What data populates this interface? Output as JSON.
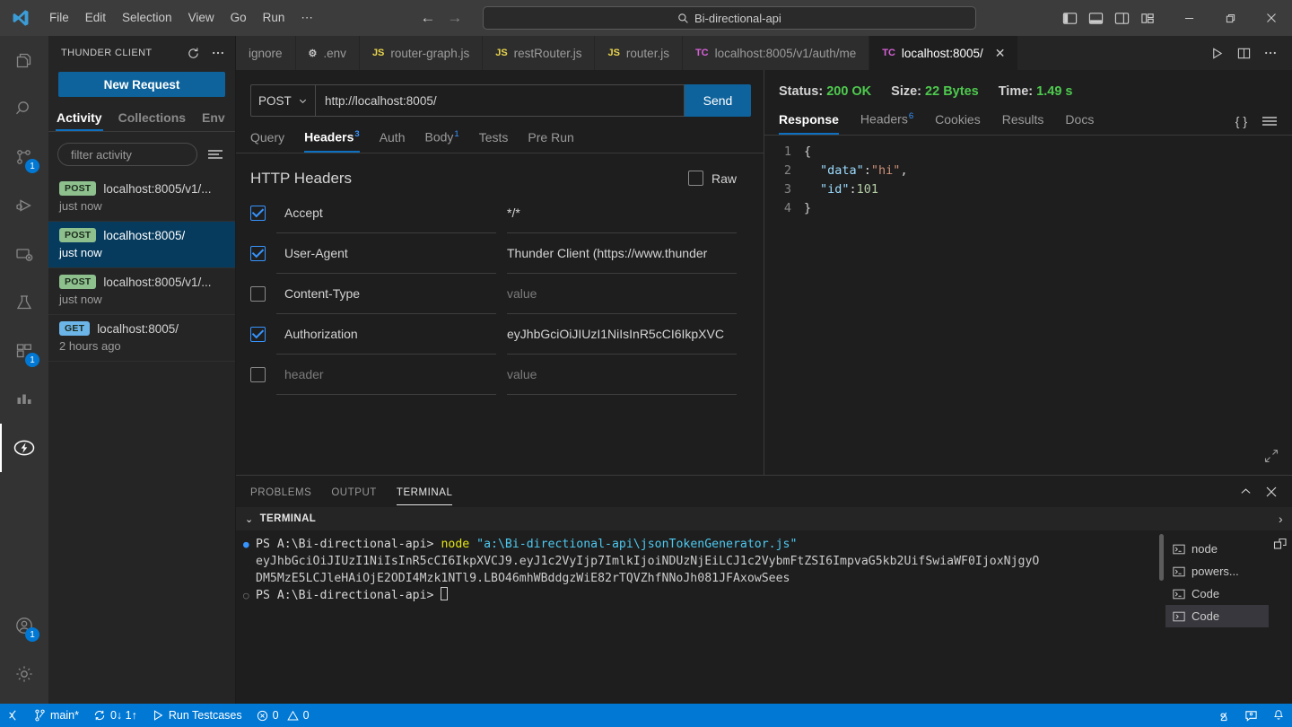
{
  "titlebar": {
    "menus": [
      "File",
      "Edit",
      "Selection",
      "View",
      "Go",
      "Run",
      "⋯"
    ],
    "search_value": "Bi-directional-api",
    "search_icon": "search-icon",
    "back_icon": "arrow-left-icon",
    "forward_icon": "arrow-right-icon",
    "layout_buttons": [
      "toggle-primary-sidebar",
      "toggle-panel",
      "toggle-secondary-sidebar",
      "customize-layout"
    ],
    "window_buttons": [
      "minimize",
      "restore",
      "close"
    ]
  },
  "activitybar": {
    "items": [
      {
        "name": "explorer",
        "icon": "files-icon",
        "badge": "",
        "active": false
      },
      {
        "name": "search",
        "icon": "search-icon",
        "badge": "",
        "active": false
      },
      {
        "name": "source-control",
        "icon": "source-control-icon",
        "badge": "1",
        "active": false
      },
      {
        "name": "run-and-debug",
        "icon": "debug-icon",
        "badge": "",
        "active": false
      },
      {
        "name": "remote-explorer",
        "icon": "remote-icon",
        "badge": "",
        "active": false
      },
      {
        "name": "testing",
        "icon": "beaker-icon",
        "badge": "",
        "active": false
      },
      {
        "name": "extensions",
        "icon": "extensions-icon",
        "badge": "1",
        "active": false
      },
      {
        "name": "chart",
        "icon": "bar-chart-icon",
        "badge": "",
        "active": false
      },
      {
        "name": "thunder-client",
        "icon": "thunderbolt-icon",
        "badge": "",
        "active": true
      }
    ],
    "bottom": [
      {
        "name": "accounts",
        "icon": "account-icon",
        "badge": "1"
      },
      {
        "name": "settings",
        "icon": "gear-icon",
        "badge": ""
      }
    ]
  },
  "sidebar": {
    "title": "THUNDER CLIENT",
    "refresh_icon": "refresh-icon",
    "more_icon": "more-icon",
    "new_request_label": "New Request",
    "tabs": [
      {
        "label": "Activity",
        "active": true
      },
      {
        "label": "Collections",
        "active": false
      },
      {
        "label": "Env",
        "active": false
      }
    ],
    "filter_placeholder": "filter activity",
    "filter_menu_icon": "filter-lines-icon",
    "activity": [
      {
        "method": "POST",
        "url": "localhost:8005/v1/...",
        "time": "just now",
        "selected": false
      },
      {
        "method": "POST",
        "url": "localhost:8005/",
        "time": "just now",
        "selected": true
      },
      {
        "method": "POST",
        "url": "localhost:8005/v1/...",
        "time": "just now",
        "selected": false
      },
      {
        "method": "GET",
        "url": "localhost:8005/",
        "time": "2 hours ago",
        "selected": false
      }
    ]
  },
  "editor_tabs": [
    {
      "label": "ignore",
      "icon": "file-icon",
      "icon_kind": "plain",
      "active": false,
      "closeable": false
    },
    {
      "label": ".env",
      "icon": "gear-icon",
      "icon_kind": "gear",
      "active": false,
      "closeable": false
    },
    {
      "label": "router-graph.js",
      "icon": "js-icon",
      "icon_kind": "js",
      "active": false,
      "closeable": false
    },
    {
      "label": "restRouter.js",
      "icon": "js-icon",
      "icon_kind": "js",
      "active": false,
      "closeable": false
    },
    {
      "label": "router.js",
      "icon": "js-icon",
      "icon_kind": "js",
      "active": false,
      "closeable": false
    },
    {
      "label": "localhost:8005/v1/auth/me",
      "icon": "thunder-client-icon",
      "icon_kind": "tc",
      "active": false,
      "closeable": false
    },
    {
      "label": "localhost:8005/",
      "icon": "thunder-client-icon",
      "icon_kind": "tc",
      "active": true,
      "closeable": true
    }
  ],
  "editor_tab_actions": [
    "run-icon",
    "split-editor-icon",
    "more-icon"
  ],
  "request": {
    "method": "POST",
    "method_chevron": "chevron-down-icon",
    "url": "http://localhost:8005/",
    "send_label": "Send",
    "tabs": [
      {
        "label": "Query",
        "badge": "",
        "active": false
      },
      {
        "label": "Headers",
        "badge": "3",
        "active": true
      },
      {
        "label": "Auth",
        "badge": "",
        "active": false
      },
      {
        "label": "Body",
        "badge": "1",
        "active": false
      },
      {
        "label": "Tests",
        "badge": "",
        "active": false
      },
      {
        "label": "Pre Run",
        "badge": "",
        "active": false
      }
    ],
    "headers_title": "HTTP Headers",
    "raw_label": "Raw",
    "raw_checked": false,
    "headers": [
      {
        "checked": true,
        "name": "Accept",
        "name_placeholder": false,
        "value": "*/*",
        "value_placeholder": false
      },
      {
        "checked": true,
        "name": "User-Agent",
        "name_placeholder": false,
        "value": "Thunder Client (https://www.thunder",
        "value_placeholder": false
      },
      {
        "checked": false,
        "name": "Content-Type",
        "name_placeholder": false,
        "value": "value",
        "value_placeholder": true
      },
      {
        "checked": true,
        "name": "Authorization",
        "name_placeholder": false,
        "value": "eyJhbGciOiJIUzI1NiIsInR5cCI6IkpXVC",
        "value_placeholder": false
      },
      {
        "checked": false,
        "name": "header",
        "name_placeholder": true,
        "value": "value",
        "value_placeholder": true
      }
    ]
  },
  "response": {
    "status_label": "Status:",
    "status_value": "200 OK",
    "size_label": "Size:",
    "size_value": "22 Bytes",
    "time_label": "Time:",
    "time_value": "1.49 s",
    "tabs": [
      {
        "label": "Response",
        "badge": "",
        "active": true
      },
      {
        "label": "Headers",
        "badge": "6",
        "active": false
      },
      {
        "label": "Cookies",
        "badge": "",
        "active": false
      },
      {
        "label": "Results",
        "badge": "",
        "active": false
      },
      {
        "label": "Docs",
        "badge": "",
        "active": false
      }
    ],
    "actions": [
      "format-json-icon",
      "menu-icon"
    ],
    "format_icon_label": "{ }",
    "body_lines": [
      {
        "num": "1",
        "tokens": [
          {
            "t": "{",
            "c": "punc"
          }
        ],
        "indent": 0
      },
      {
        "num": "2",
        "tokens": [
          {
            "t": "\"data\"",
            "c": "key"
          },
          {
            "t": ": ",
            "c": "punc"
          },
          {
            "t": "\"hi\"",
            "c": "str"
          },
          {
            "t": ",",
            "c": "punc"
          }
        ],
        "indent": 1
      },
      {
        "num": "3",
        "tokens": [
          {
            "t": "\"id\"",
            "c": "key"
          },
          {
            "t": ": ",
            "c": "punc"
          },
          {
            "t": "101",
            "c": "num"
          }
        ],
        "indent": 1
      },
      {
        "num": "4",
        "tokens": [
          {
            "t": "}",
            "c": "punc"
          }
        ],
        "indent": 0
      }
    ],
    "resize_grip_icon": "resize-grip-icon"
  },
  "panel": {
    "tabs": [
      {
        "label": "PROBLEMS",
        "active": false
      },
      {
        "label": "OUTPUT",
        "active": false
      },
      {
        "label": "TERMINAL",
        "active": true
      }
    ],
    "actions": [
      "chevron-up-icon",
      "close-icon"
    ],
    "terminal_group_label": "TERMINAL",
    "terminal_group_chevron": "chevron-down-icon",
    "terminal_more_icon": "chevron-right-icon",
    "terminal_lines": [
      {
        "bullet": "active",
        "segments": [
          {
            "t": "PS A:\\Bi-directional-api> ",
            "c": "cmd"
          },
          {
            "t": "node ",
            "c": "node"
          },
          {
            "t": "\"a:\\Bi-directional-api\\jsonTokenGenerator.js\"",
            "c": "path"
          }
        ]
      },
      {
        "bullet": "none",
        "segments": [
          {
            "t": "eyJhbGciOiJIUzI1NiIsInR5cCI6IkpXVCJ9.eyJ1c2VyIjp7ImlkIjoiNDUzNjEiLCJ1c2VybmFtZSI6ImpvaG5kb2UifSwiaWF0IjoxNjgyO",
            "c": "tok"
          }
        ]
      },
      {
        "bullet": "none",
        "segments": [
          {
            "t": "DM5MzE5LCJleHAiOjE2ODI4Mzk1NTl9.LBO46mhWBddgzWiE82rTQVZhfNNoJh081JFAxowSees",
            "c": "tok"
          }
        ]
      },
      {
        "bullet": "inactive",
        "segments": [
          {
            "t": "PS A:\\Bi-directional-api> ",
            "c": "cmd"
          }
        ],
        "cursor": true
      }
    ],
    "terminal_list": [
      {
        "label": "node",
        "icon": "terminal-icon",
        "active": false
      },
      {
        "label": "powers...",
        "icon": "terminal-icon",
        "active": false
      },
      {
        "label": "Code",
        "icon": "terminal-icon",
        "active": false
      },
      {
        "label": "Code",
        "icon": "terminal-icon",
        "active": true
      }
    ],
    "terminal_side_action": "split-terminal-icon"
  },
  "statusbar": {
    "remote_icon": "remote-window-icon",
    "branch_icon": "git-branch-icon",
    "branch": "main*",
    "sync_icon": "sync-icon",
    "sync_text": "0↓ 1↑",
    "run_icon": "play-icon",
    "run_label": "Run Testcases",
    "error_icon": "error-icon",
    "errors": "0",
    "warning_icon": "warning-icon",
    "warnings": "0",
    "right_items": [
      {
        "name": "squirrel-icon"
      },
      {
        "name": "feedback-icon"
      },
      {
        "name": "bell-icon"
      }
    ]
  }
}
